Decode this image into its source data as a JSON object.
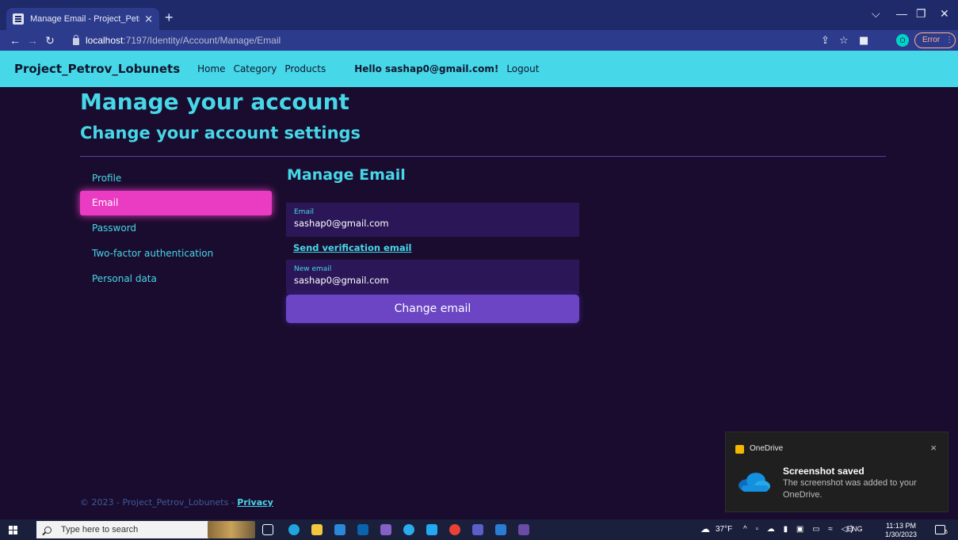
{
  "browser": {
    "tab_title": "Manage Email - Project_Petrov_L",
    "tab_close": "×",
    "new_tab": "+",
    "url_host": "localhost",
    "url_path": ":7197/Identity/Account/Manage/Email",
    "profile_initial": "O",
    "error_label": "Error",
    "error_menu": "⋮"
  },
  "navbar": {
    "brand": "Project_Petrov_Lobunets",
    "links": [
      "Home",
      "Category",
      "Products"
    ],
    "greeting": "Hello sashap0@gmail.com!",
    "logout": "Logout"
  },
  "page": {
    "title": "Manage your account",
    "subtitle": "Change your account settings"
  },
  "sidebar": {
    "items": [
      {
        "label": "Profile"
      },
      {
        "label": "Email"
      },
      {
        "label": "Password"
      },
      {
        "label": "Two-factor authentication"
      },
      {
        "label": "Personal data"
      }
    ],
    "active": "Email"
  },
  "email_section": {
    "title": "Manage Email",
    "email_label": "Email",
    "email_value": "sashap0@gmail.com",
    "verify_link": "Send verification email",
    "new_email_label": "New email",
    "new_email_value": "sashap0@gmail.com",
    "change_button": "Change email"
  },
  "footer": {
    "text": "© 2023 - Project_Petrov_Lobunets - ",
    "privacy": "Privacy"
  },
  "toast": {
    "app_name": "OneDrive",
    "close": "×",
    "title": "Screenshot saved",
    "body": "The screenshot was added to your OneDrive."
  },
  "taskbar": {
    "search_placeholder": "Type here to search",
    "temperature": "37°F",
    "language": "ENG",
    "time": "11:13 PM",
    "date": "1/30/2023",
    "notif_count": "6"
  },
  "colors": {
    "navbar_bg": "#46d7e8",
    "page_bg": "#1a0c2e",
    "accent_cyan": "#46d7e8",
    "active_pink": "#ea3bc3",
    "button_purple": "#6b45c4",
    "field_bg": "#2b1758"
  },
  "icons": [
    "tab-favicon-icon",
    "back-arrow-icon",
    "forward-arrow-icon",
    "reload-icon",
    "lock-icon",
    "share-icon",
    "star-icon",
    "sidebar-icon",
    "onedrive-icon",
    "cloud-icon",
    "windows-start-icon",
    "search-icon",
    "notification-icon"
  ]
}
